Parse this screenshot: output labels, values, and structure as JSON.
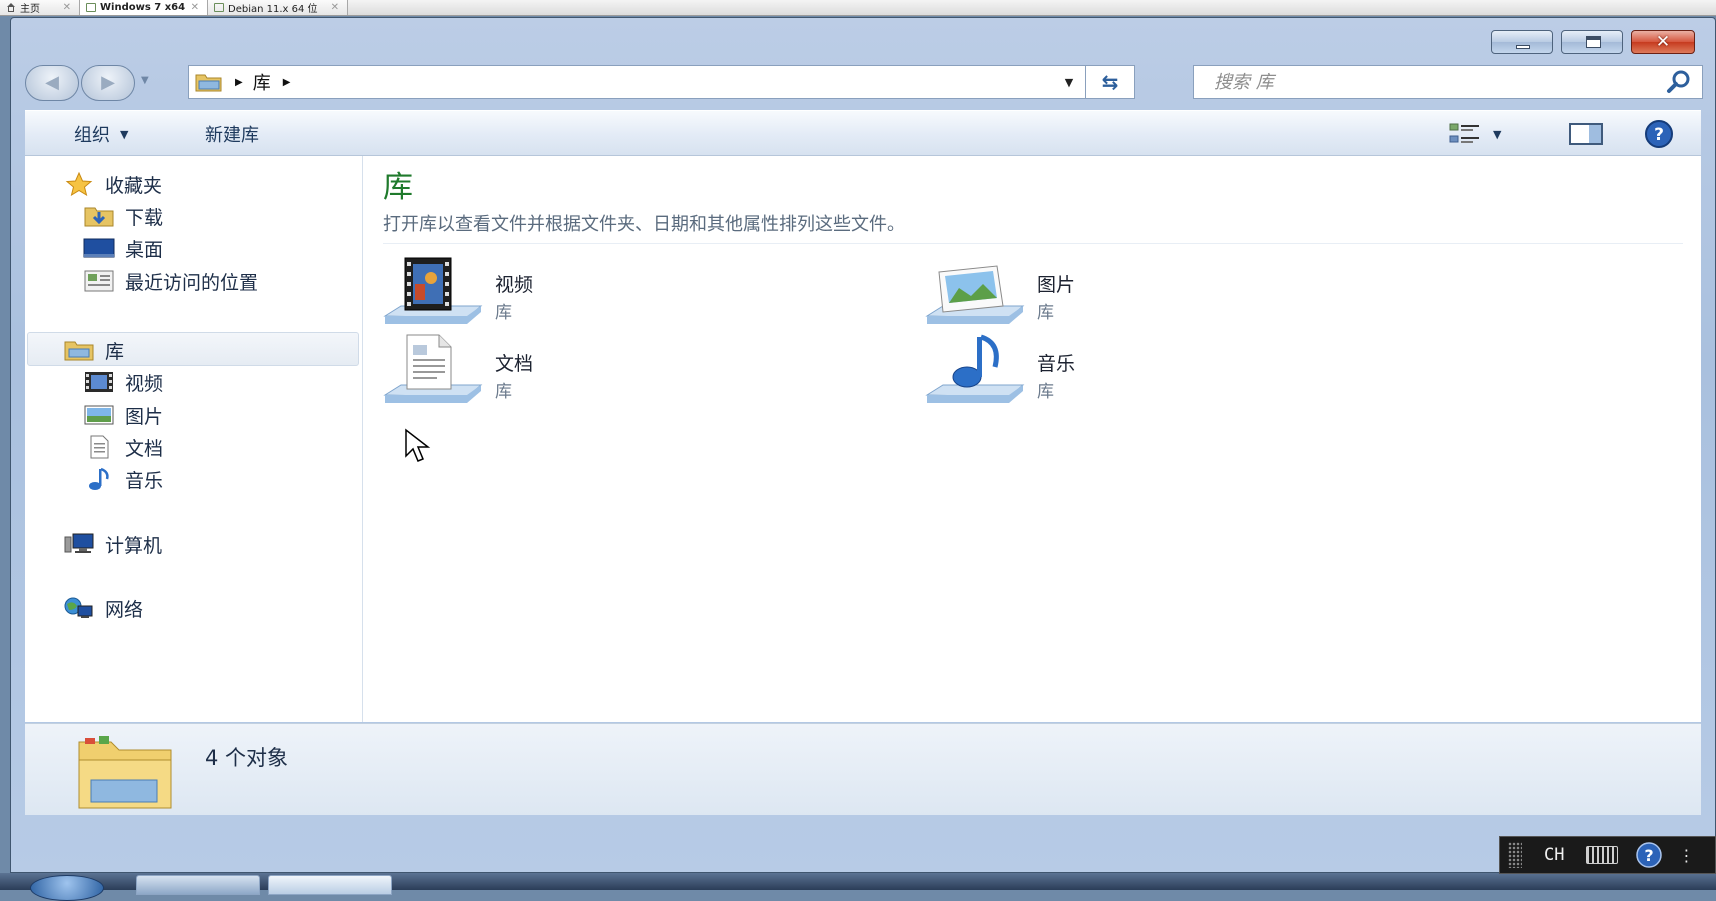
{
  "vm_tabs": [
    {
      "label": "主页",
      "active": false
    },
    {
      "label": "Windows 7 x64",
      "active": true
    },
    {
      "label": "Debian 11.x 64 位",
      "active": false
    }
  ],
  "address": {
    "path": [
      "库"
    ]
  },
  "search": {
    "placeholder": "搜索 库"
  },
  "toolbar": {
    "organize": "组织",
    "new_library": "新建库"
  },
  "nav_pane": {
    "favorites": "收藏夹",
    "downloads": "下载",
    "desktop": "桌面",
    "recent": "最近访问的位置",
    "libraries": "库",
    "videos": "视频",
    "pictures": "图片",
    "documents": "文档",
    "music": "音乐",
    "computer": "计算机",
    "network": "网络"
  },
  "content": {
    "title": "库",
    "description": "打开库以查看文件并根据文件夹、日期和其他属性排列这些文件。",
    "items": [
      {
        "name": "视频",
        "type": "库",
        "icon": "video-library-icon"
      },
      {
        "name": "图片",
        "type": "库",
        "icon": "pictures-library-icon"
      },
      {
        "name": "文档",
        "type": "库",
        "icon": "documents-library-icon"
      },
      {
        "name": "音乐",
        "type": "库",
        "icon": "music-library-icon"
      }
    ]
  },
  "details": {
    "count": "4 个对象"
  },
  "language_bar": {
    "lang": "CH"
  },
  "colors": {
    "title_green": "#1f7a2c",
    "accent_blue": "#2d5f9c",
    "close_red": "#c63b1f"
  }
}
